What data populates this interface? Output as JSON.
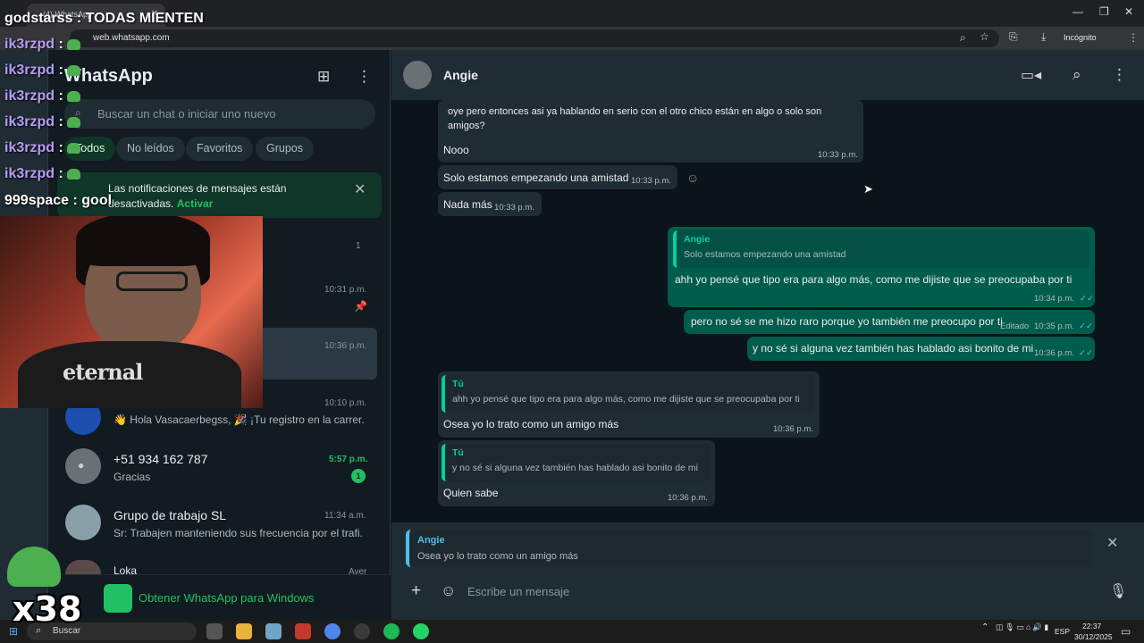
{
  "browser": {
    "tab_title": "(4) WhatsApp",
    "url": "web.whatsapp.com",
    "incognito_label": "Incógnito"
  },
  "whatsapp": {
    "app_title": "WhatsApp",
    "search_placeholder": "Buscar un chat o iniciar uno nuevo",
    "filters": [
      "Todos",
      "No leídos",
      "Favoritos",
      "Grupos"
    ],
    "notification": {
      "text": "Las notificaciones de mensajes están desactivadas.",
      "link": "Activar"
    },
    "chats": [
      {
        "name": "",
        "preview": "",
        "time": "",
        "badge": "1"
      },
      {
        "name": "",
        "preview": "",
        "time": "10:31 p.m."
      },
      {
        "name": "",
        "preview": "",
        "time": "10:36 p.m."
      },
      {
        "name": "",
        "preview": "👋 Hola Vasacaerbegss, 🎉 ¡Tu registro en la carrer...",
        "time": "10:10 p.m."
      },
      {
        "name": "+51 934 162 787",
        "preview": "Gracias",
        "time": "5:57 p.m.",
        "badge": "1"
      },
      {
        "name": "Grupo de trabajo SL",
        "preview": "Sr: Trabajen manteniendo sus frecuencia por el trafi...",
        "time": "11:34 a.m."
      },
      {
        "name": "Loka",
        "preview": "",
        "time": "Ayer"
      }
    ],
    "get_app": "Obtener WhatsApp para Windows"
  },
  "conversation": {
    "contact": "Angie",
    "messages": [
      {
        "dir": "in",
        "text": "oye pero entonces asi ya hablando en serio con el otro chico están en algo o solo son amigos?"
      },
      {
        "dir": "in",
        "text": "Nooo",
        "time": "10:33 p.m."
      },
      {
        "dir": "in",
        "text": "Solo estamos empezando una amistad",
        "time": "10:33 p.m."
      },
      {
        "dir": "in",
        "text": "Nada más",
        "time": "10:33 p.m."
      },
      {
        "dir": "out",
        "quote_name": "Angie",
        "quote_text": "Solo estamos empezando una amistad",
        "text": "ahh yo pensé que tipo era para algo más, como me dijiste que se preocupaba por ti",
        "time": "10:34 p.m."
      },
      {
        "dir": "out",
        "text": "pero no sé se me hizo raro porque yo también me preocupo por ti",
        "edited": "Editado",
        "time": "10:35 p.m."
      },
      {
        "dir": "out",
        "text": "y no sé si alguna vez también has hablado asi bonito de mi",
        "time": "10:36 p.m."
      },
      {
        "dir": "in",
        "quote_name": "Tú",
        "quote_text": "ahh yo pensé que tipo era para algo más, como me dijiste que se preocupaba por ti",
        "text": "Osea yo lo trato como un amigo más",
        "time": "10:36 p.m."
      },
      {
        "dir": "in",
        "quote_name": "Tú",
        "quote_text": "y no sé si alguna vez también has hablado asi bonito de mi",
        "text": "Quien sabe",
        "time": "10:36 p.m."
      }
    ],
    "reply_to": {
      "name": "Angie",
      "text": "Osea yo lo trato como un amigo más"
    },
    "input_placeholder": "Escribe un mensaje"
  },
  "taskbar": {
    "search": "Buscar",
    "lang": "ESP",
    "time": "22:37",
    "date": "30/12/2025"
  },
  "stream_overlay": {
    "lines": [
      {
        "user": "godstarss",
        "text": "TODAS MIENTEN"
      },
      {
        "user": "ik3rzpd",
        "text": ""
      },
      {
        "user": "ik3rzpd",
        "text": ""
      },
      {
        "user": "ik3rzpd",
        "text": ""
      },
      {
        "user": "ik3rzpd",
        "text": ""
      },
      {
        "user": "ik3rzpd",
        "text": ""
      },
      {
        "user": "ik3rzpd",
        "text": ""
      },
      {
        "user": "999space",
        "text": "gool"
      }
    ],
    "webcam_shirt_text": "eternal",
    "combo": "x38"
  },
  "colors": {
    "wa_green": "#21c063",
    "outgoing_bubble": "#005c4b",
    "incoming_bubble": "#202c33",
    "quote_blue": "#53bdeb"
  }
}
